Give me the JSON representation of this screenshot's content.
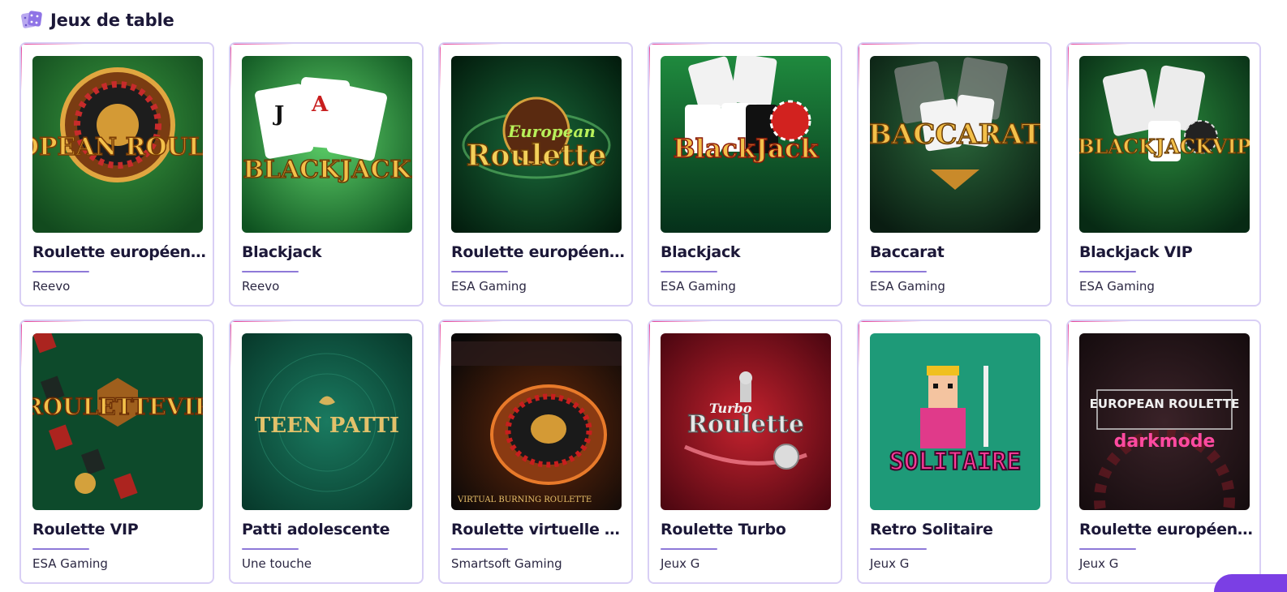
{
  "section": {
    "title": "Jeux de table",
    "icon": "dice-icon"
  },
  "games": [
    {
      "title": "Roulette européenne",
      "provider": "Reevo",
      "art": "EUROPEAN ROULETTE",
      "bg": "#1f6b2c"
    },
    {
      "title": "Blackjack",
      "provider": "Reevo",
      "art": "BLACKJACK",
      "bg": "#1d7a34"
    },
    {
      "title": "Roulette européenne",
      "provider": "ESA Gaming",
      "art": "Roulette",
      "art_sub": "European",
      "bg": "#0c3a22"
    },
    {
      "title": "Blackjack",
      "provider": "ESA Gaming",
      "art": "BlackJack",
      "bg": "#0f5a2c"
    },
    {
      "title": "Baccarat",
      "provider": "ESA Gaming",
      "art": "BACCARAT",
      "bg": "#11301e"
    },
    {
      "title": "Blackjack VIP",
      "provider": "ESA Gaming",
      "art": "BLACKJACKVIP",
      "bg": "#0e4a26"
    },
    {
      "title": "Roulette VIP",
      "provider": "ESA Gaming",
      "art": "ROULETTEVIP",
      "bg": "#0d4a2b"
    },
    {
      "title": "Patti adolescente",
      "provider": "Une touche",
      "art": "TEEN PATTI",
      "bg": "#0f5c48"
    },
    {
      "title": "Roulette virtuelle brûlante",
      "provider": "Smartsoft Gaming",
      "art": "VIRTUAL BURNING ROULETTE",
      "bg": "#1a0f0c"
    },
    {
      "title": "Roulette Turbo",
      "provider": "Jeux G",
      "art": "Roulette",
      "art_sub": "Turbo",
      "bg": "#7d0e18"
    },
    {
      "title": "Retro Solitaire",
      "provider": "Jeux G",
      "art": "SOLITAIRE",
      "bg": "#1e9a78"
    },
    {
      "title": "Roulette européenne",
      "provider": "Jeux G",
      "art": "EUROPEAN ROULETTE",
      "art_sub": "darkmode",
      "bg": "#26181c"
    }
  ]
}
